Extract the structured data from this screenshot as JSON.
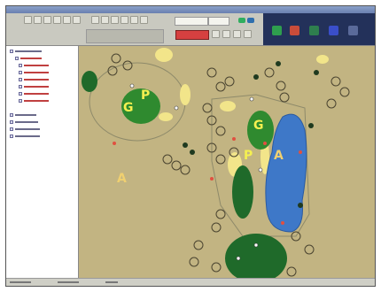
{
  "window": {
    "title": ""
  },
  "map": {
    "labels": {
      "green_left": "G",
      "pin_left": "P",
      "green_right": "G",
      "pin_right": "P",
      "area_center": "A",
      "area_left": "A"
    }
  },
  "colors": {
    "fairway": "#c2b482",
    "green": "#2f8a2f",
    "water": "#3e78c8",
    "sand": "#f2e58a",
    "label": "#f5f050",
    "label_area": "#f0d070"
  }
}
